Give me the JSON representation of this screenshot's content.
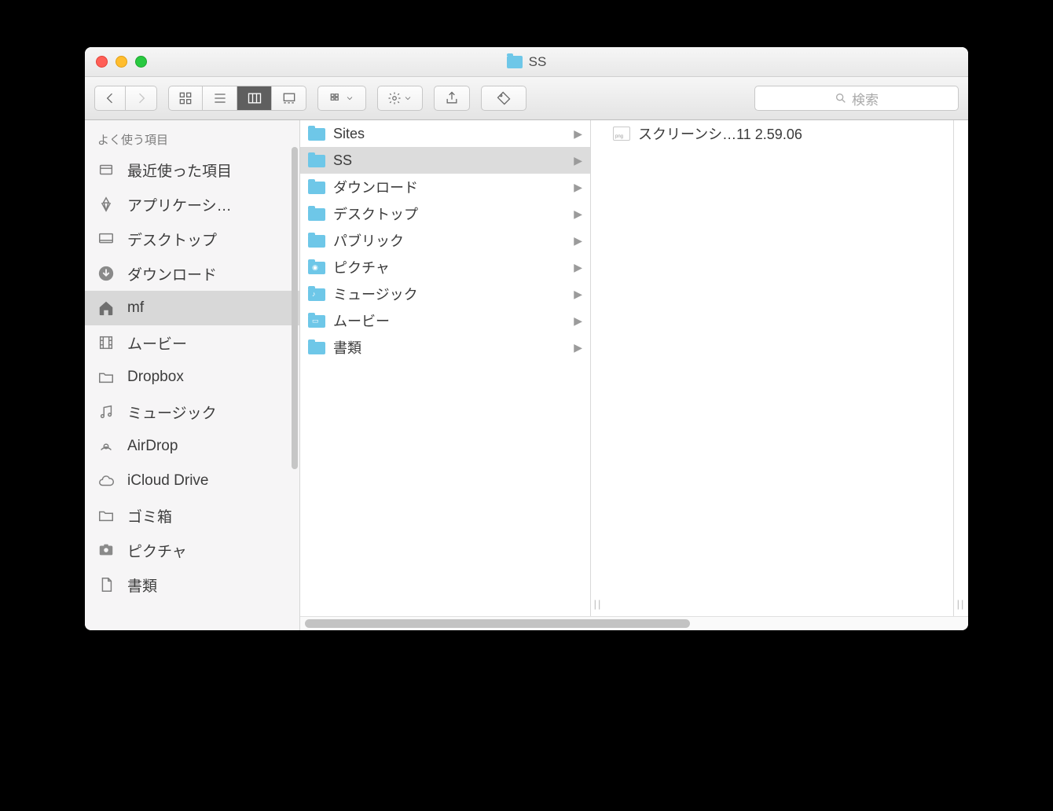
{
  "window": {
    "title": "SS"
  },
  "search": {
    "placeholder": "検索"
  },
  "sidebar": {
    "header": "よく使う項目",
    "items": [
      {
        "label": "最近使った項目",
        "icon": "recents"
      },
      {
        "label": "アプリケーシ…",
        "icon": "apps"
      },
      {
        "label": "デスクトップ",
        "icon": "desktop"
      },
      {
        "label": "ダウンロード",
        "icon": "downloads"
      },
      {
        "label": "mf",
        "icon": "home",
        "selected": true
      },
      {
        "label": "ムービー",
        "icon": "movies"
      },
      {
        "label": "Dropbox",
        "icon": "folder"
      },
      {
        "label": "ミュージック",
        "icon": "music"
      },
      {
        "label": "AirDrop",
        "icon": "airdrop"
      },
      {
        "label": "iCloud Drive",
        "icon": "icloud"
      },
      {
        "label": "ゴミ箱",
        "icon": "folder"
      },
      {
        "label": "ピクチャ",
        "icon": "pictures"
      },
      {
        "label": "書類",
        "icon": "documents"
      }
    ]
  },
  "column1": {
    "items": [
      {
        "label": "Sites",
        "glyph": ""
      },
      {
        "label": "SS",
        "glyph": "",
        "selected": true
      },
      {
        "label": "ダウンロード",
        "glyph": ""
      },
      {
        "label": "デスクトップ",
        "glyph": ""
      },
      {
        "label": "パブリック",
        "glyph": ""
      },
      {
        "label": "ピクチャ",
        "glyph": "◉"
      },
      {
        "label": "ミュージック",
        "glyph": "♪"
      },
      {
        "label": "ムービー",
        "glyph": "▭"
      },
      {
        "label": "書類",
        "glyph": ""
      }
    ]
  },
  "column2": {
    "items": [
      {
        "label": "スクリーンシ…11 2.59.06"
      }
    ]
  }
}
